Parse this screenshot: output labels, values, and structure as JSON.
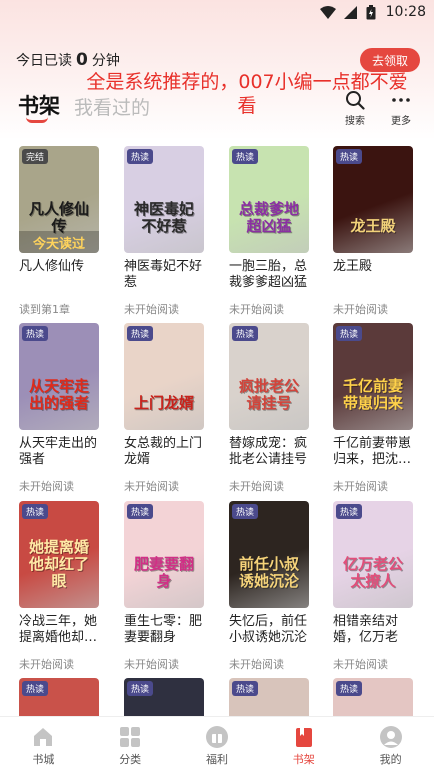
{
  "status": {
    "time": "10:28"
  },
  "header": {
    "read_prefix": "今日已读",
    "read_minutes": "0",
    "read_suffix": "分钟",
    "claim_label": "去领取",
    "overlay_caption": "全是系统推荐的，007小编一点都不爱看"
  },
  "tabs": {
    "shelf": "书架",
    "history": "我看过的"
  },
  "tools": {
    "search": "搜索",
    "more": "更多"
  },
  "books": [
    {
      "title": "凡人修仙传",
      "cover_text": "凡人修仙传",
      "tag": "完结",
      "status": "读到第1章",
      "banner": "今天读过",
      "bg": "#a9a58a",
      "fg": "#1b1b1b"
    },
    {
      "title": "神医毒妃不好惹",
      "cover_text": "神医毒妃不好惹",
      "tag": "热读",
      "status": "未开始阅读",
      "bg": "#d8cfe3",
      "fg": "#2a2a2a"
    },
    {
      "title": "一胞三胎，总裁爹爹超凶猛",
      "cover_text": "总裁爹地超凶猛",
      "tag": "热读",
      "status": "未开始阅读",
      "bg": "#c7e3b0",
      "fg": "#8b2fa3"
    },
    {
      "title": "龙王殿",
      "cover_text": "龙王殿",
      "tag": "热读",
      "status": "未开始阅读",
      "bg": "#3b1410",
      "fg": "#f2d27a"
    },
    {
      "title": "从天牢走出的强者",
      "cover_text": "从天牢走出的强者",
      "tag": "热读",
      "status": "未开始阅读",
      "bg": "#9c8fb7",
      "fg": "#e02a1a"
    },
    {
      "title": "女总裁的上门龙婿",
      "cover_text": "上门龙婿",
      "tag": "热读",
      "status": "未开始阅读",
      "bg": "#e9d4c8",
      "fg": "#c8221b"
    },
    {
      "title": "替嫁成宠：疯批老公请挂号",
      "cover_text": "疯批老公请挂号",
      "tag": "热读",
      "status": "未开始阅读",
      "bg": "#d9d2cc",
      "fg": "#d2443b"
    },
    {
      "title": "千亿前妻带崽归来，把沈…",
      "cover_text": "千亿前妻带崽归来",
      "tag": "热读",
      "status": "未开始阅读",
      "bg": "#5b3a3a",
      "fg": "#ffd24a"
    },
    {
      "title": "冷战三年，她提离婚他却…",
      "cover_text": "她提离婚他却红了眼",
      "tag": "热读",
      "status": "未开始阅读",
      "bg": "#c84a43",
      "fg": "#ffe9a6"
    },
    {
      "title": "重生七零：肥妻要翻身",
      "cover_text": "肥妻要翻身",
      "tag": "热读",
      "status": "未开始阅读",
      "bg": "#f3d3d6",
      "fg": "#d12f86"
    },
    {
      "title": "失忆后，前任小叔诱她沉沦",
      "cover_text": "前任小叔诱她沉沦",
      "tag": "热读",
      "status": "未开始阅读",
      "bg": "#2d2520",
      "fg": "#f5d37a"
    },
    {
      "title": "相错亲结对婚，亿万老公…",
      "cover_text": "亿万老公太撩人",
      "tag": "热读",
      "status": "未开始阅读",
      "bg": "#e6d3e6",
      "fg": "#e24e7a"
    },
    {
      "title": "",
      "cover_text": "",
      "tag": "热读",
      "status": "",
      "bg": "#c9524a",
      "fg": "#fff"
    },
    {
      "title": "",
      "cover_text": "",
      "tag": "热读",
      "status": "",
      "bg": "#2f3040",
      "fg": "#fff"
    },
    {
      "title": "",
      "cover_text": "",
      "tag": "热读",
      "status": "",
      "bg": "#d8c4bb",
      "fg": "#fff"
    },
    {
      "title": "",
      "cover_text": "",
      "tag": "热读",
      "status": "",
      "bg": "#e4c6c3",
      "fg": "#fff"
    }
  ],
  "nav": [
    {
      "label": "书城",
      "icon": "home-icon",
      "active": false
    },
    {
      "label": "分类",
      "icon": "category-icon",
      "active": false
    },
    {
      "label": "福利",
      "icon": "gift-icon",
      "active": false
    },
    {
      "label": "书架",
      "icon": "bookshelf-icon",
      "active": true
    },
    {
      "label": "我的",
      "icon": "profile-icon",
      "active": false
    }
  ],
  "colors": {
    "accent": "#e5473f",
    "caption": "#e8302a",
    "tag": "#4b4a8c"
  }
}
